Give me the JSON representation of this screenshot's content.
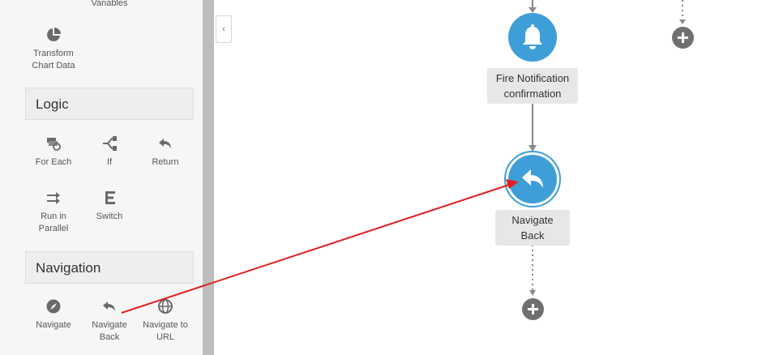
{
  "palette": {
    "partial_top_label": "Variables",
    "transform_chart_data": "Transform Chart Data",
    "logic": {
      "title": "Logic",
      "items": [
        "For Each",
        "If",
        "Return",
        "Run in Parallel",
        "Switch"
      ]
    },
    "navigation": {
      "title": "Navigation",
      "items": [
        "Navigate",
        "Navigate Back",
        "Navigate to URL"
      ]
    }
  },
  "canvas": {
    "fire_notification_label": "Fire Notification confirmation",
    "navigate_back_label": "Navigate Back"
  },
  "icons": {
    "collapse": "chevron-left-icon",
    "fire_notification": "bell-icon",
    "navigate_back": "undo-arrow-icon",
    "add": "plus-icon"
  },
  "colors": {
    "node_blue": "#3e9fd8",
    "annotation_arrow": "#e0201f",
    "plus_gray": "#707070"
  }
}
